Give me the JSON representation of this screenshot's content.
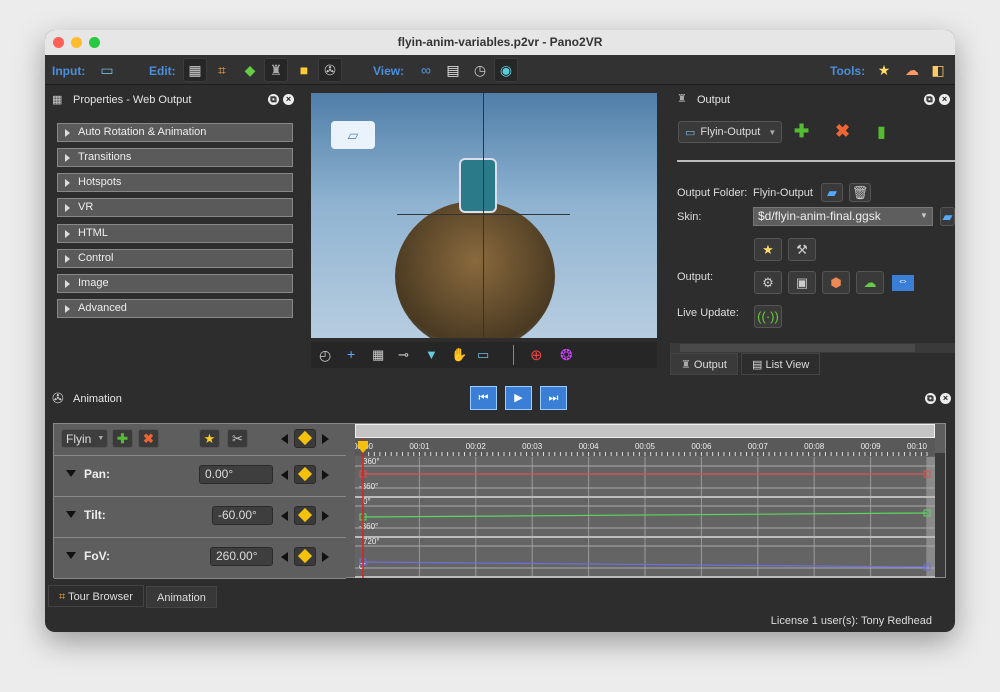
{
  "window": {
    "title": "flyin-anim-variables.p2vr - Pano2VR"
  },
  "toolbar": {
    "input_label": "Input:",
    "edit_label": "Edit:",
    "view_label": "View:",
    "tools_label": "Tools:",
    "input_icons": [
      "add-panorama-icon"
    ],
    "edit_icons": [
      "properties-icon",
      "tour-map-icon",
      "floor-plan-icon",
      "output-icon",
      "google-street-view-icon",
      "animation-icon"
    ],
    "view_icons": [
      "binoculars-icon",
      "clipboard-icon",
      "compass-icon",
      "eye-icon"
    ],
    "tools_icons": [
      "star-patch-icon",
      "weather-icon",
      "eraser-icon"
    ]
  },
  "properties": {
    "title": "Properties - Web Output",
    "sections": [
      "Auto Rotation & Animation",
      "Transitions",
      "Hotspots",
      "VR",
      "HTML",
      "Control",
      "Image",
      "Advanced"
    ]
  },
  "output": {
    "title": "Output",
    "selected_output": "Flyin-Output",
    "output_folder_label": "Output Folder:",
    "output_folder_value": "Flyin-Output",
    "skin_label": "Skin:",
    "skin_value": "$d/flyin-anim-final.ggsk",
    "output_label": "Output:",
    "live_update_label": "Live Update:",
    "tabs": [
      "Output",
      "List View"
    ]
  },
  "animation": {
    "title": "Animation",
    "sequence": "Flyin",
    "tracks": [
      {
        "name": "Pan:",
        "value": "0.00°",
        "max": "360°",
        "min": "-360°",
        "color": "#d9534f"
      },
      {
        "name": "Tilt:",
        "value": "-60.00°",
        "max": "0°",
        "min": "-360°",
        "color": "#5cd65c"
      },
      {
        "name": "FoV:",
        "value": "260.00°",
        "max": "720°",
        "min": "0°",
        "color": "#6f6fe0"
      }
    ],
    "time_labels": [
      "00:00",
      "00:01",
      "00:02",
      "00:03",
      "00:04",
      "00:05",
      "00:06",
      "00:07",
      "00:08",
      "00:09",
      "00:10"
    ],
    "current_time": "00:00"
  },
  "bottom_tabs": [
    "Tour Browser",
    "Animation"
  ],
  "status": {
    "license": "License 1 user(s): Tony Redhead"
  }
}
